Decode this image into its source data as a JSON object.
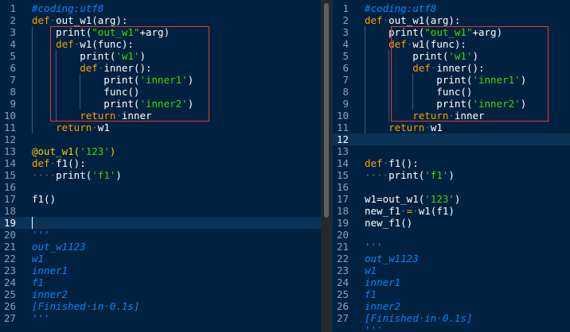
{
  "editor": {
    "left_pane": {
      "line_numbers": [
        "1",
        "2",
        "3",
        "4",
        "5",
        "6",
        "7",
        "8",
        "9",
        "10",
        "11",
        "12",
        "13",
        "14",
        "15",
        "16",
        "17",
        "18",
        "19",
        "20",
        "21",
        "22",
        "23",
        "24",
        "25",
        "26",
        "27"
      ],
      "active_line": 19,
      "lines": [
        [
          {
            "t": "#coding:utf8",
            "c": "c-comment"
          }
        ],
        [
          {
            "t": "def",
            "c": "c-key"
          },
          {
            "t": "·",
            "c": "ws-dot"
          },
          {
            "t": "out_w1",
            "c": "c-plain"
          },
          {
            "t": "(arg):",
            "c": "c-plain"
          }
        ],
        [
          {
            "t": "    print(",
            "c": "c-plain"
          },
          {
            "t": "\"out_w1\"",
            "c": "c-str"
          },
          {
            "t": "+arg)",
            "c": "c-plain"
          }
        ],
        [
          {
            "t": "    ",
            "c": "c-plain"
          },
          {
            "t": "def",
            "c": "c-key"
          },
          {
            "t": "·",
            "c": "ws-dot"
          },
          {
            "t": "w1(func):",
            "c": "c-plain"
          }
        ],
        [
          {
            "t": "        print(",
            "c": "c-plain"
          },
          {
            "t": "'w1'",
            "c": "c-str"
          },
          {
            "t": ")",
            "c": "c-plain"
          }
        ],
        [
          {
            "t": "        ",
            "c": "c-plain"
          },
          {
            "t": "def",
            "c": "c-key"
          },
          {
            "t": "·",
            "c": "ws-dot"
          },
          {
            "t": "inner():",
            "c": "c-plain"
          }
        ],
        [
          {
            "t": "            print(",
            "c": "c-plain"
          },
          {
            "t": "'inner1'",
            "c": "c-str"
          },
          {
            "t": ")",
            "c": "c-plain"
          }
        ],
        [
          {
            "t": "            func()",
            "c": "c-plain"
          }
        ],
        [
          {
            "t": "            print(",
            "c": "c-plain"
          },
          {
            "t": "'inner2'",
            "c": "c-str"
          },
          {
            "t": ")",
            "c": "c-plain"
          }
        ],
        [
          {
            "t": "        ",
            "c": "c-plain"
          },
          {
            "t": "return",
            "c": "c-key"
          },
          {
            "t": "·",
            "c": "ws-dot"
          },
          {
            "t": "inner",
            "c": "c-plain"
          }
        ],
        [
          {
            "t": "    ",
            "c": "c-plain"
          },
          {
            "t": "return",
            "c": "c-key"
          },
          {
            "t": "·",
            "c": "ws-dot"
          },
          {
            "t": "w1",
            "c": "c-plain"
          }
        ],
        [],
        [
          {
            "t": "@out_w1(",
            "c": "c-deco"
          },
          {
            "t": "'123'",
            "c": "c-str"
          },
          {
            "t": ")",
            "c": "c-deco"
          }
        ],
        [
          {
            "t": "def",
            "c": "c-key"
          },
          {
            "t": "·",
            "c": "ws-dot"
          },
          {
            "t": "f1():",
            "c": "c-plain"
          }
        ],
        [
          {
            "t": "····",
            "c": "ws-dot"
          },
          {
            "t": "print(",
            "c": "c-plain"
          },
          {
            "t": "'f1'",
            "c": "c-str"
          },
          {
            "t": ")",
            "c": "c-plain"
          }
        ],
        [],
        [
          {
            "t": "f1()",
            "c": "c-plain"
          }
        ],
        [],
        [],
        [
          {
            "t": "'''",
            "c": "c-comment"
          }
        ],
        [
          {
            "t": "out_w1123",
            "c": "c-comment"
          }
        ],
        [
          {
            "t": "w1",
            "c": "c-comment"
          }
        ],
        [
          {
            "t": "inner1",
            "c": "c-comment"
          }
        ],
        [
          {
            "t": "f1",
            "c": "c-comment"
          }
        ],
        [
          {
            "t": "inner2",
            "c": "c-comment"
          }
        ],
        [
          {
            "t": "[Finished",
            "c": "c-comment"
          },
          {
            "t": "·",
            "c": "ws-dot"
          },
          {
            "t": "in",
            "c": "c-comment"
          },
          {
            "t": "·",
            "c": "ws-dot"
          },
          {
            "t": "0.1s]",
            "c": "c-comment"
          }
        ],
        [
          {
            "t": "'''",
            "c": "c-comment"
          }
        ]
      ]
    },
    "right_pane": {
      "line_numbers": [
        "1",
        "2",
        "3",
        "4",
        "5",
        "6",
        "7",
        "8",
        "9",
        "10",
        "11",
        "12",
        "13",
        "14",
        "15",
        "16",
        "17",
        "18",
        "19",
        "20",
        "21",
        "22",
        "23",
        "24",
        "25",
        "26",
        "27"
      ],
      "active_line": 12,
      "lines": [
        [
          {
            "t": "#coding:utf8",
            "c": "c-comment"
          }
        ],
        [
          {
            "t": "def",
            "c": "c-key"
          },
          {
            "t": "·",
            "c": "ws-dot"
          },
          {
            "t": "out_w1",
            "c": "c-plain"
          },
          {
            "t": "(arg):",
            "c": "c-plain"
          }
        ],
        [
          {
            "t": "    print(",
            "c": "c-plain"
          },
          {
            "t": "\"out_w1\"",
            "c": "c-str"
          },
          {
            "t": "+arg)",
            "c": "c-plain"
          }
        ],
        [
          {
            "t": "    ",
            "c": "c-plain"
          },
          {
            "t": "def",
            "c": "c-key"
          },
          {
            "t": "·",
            "c": "ws-dot"
          },
          {
            "t": "w1(func):",
            "c": "c-plain"
          }
        ],
        [
          {
            "t": "        print(",
            "c": "c-plain"
          },
          {
            "t": "'w1'",
            "c": "c-str"
          },
          {
            "t": ")",
            "c": "c-plain"
          }
        ],
        [
          {
            "t": "        ",
            "c": "c-plain"
          },
          {
            "t": "def",
            "c": "c-key"
          },
          {
            "t": "·",
            "c": "ws-dot"
          },
          {
            "t": "inner():",
            "c": "c-plain"
          }
        ],
        [
          {
            "t": "            print(",
            "c": "c-plain"
          },
          {
            "t": "'inner1'",
            "c": "c-str"
          },
          {
            "t": ")",
            "c": "c-plain"
          }
        ],
        [
          {
            "t": "            func()",
            "c": "c-plain"
          }
        ],
        [
          {
            "t": "            print(",
            "c": "c-plain"
          },
          {
            "t": "'inner2'",
            "c": "c-str"
          },
          {
            "t": ")",
            "c": "c-plain"
          }
        ],
        [
          {
            "t": "        ",
            "c": "c-plain"
          },
          {
            "t": "return",
            "c": "c-key"
          },
          {
            "t": "·",
            "c": "ws-dot"
          },
          {
            "t": "inner",
            "c": "c-plain"
          }
        ],
        [
          {
            "t": "    ",
            "c": "c-plain"
          },
          {
            "t": "return",
            "c": "c-key"
          },
          {
            "t": "·",
            "c": "ws-dot"
          },
          {
            "t": "w1",
            "c": "c-plain"
          }
        ],
        [],
        [],
        [
          {
            "t": "def",
            "c": "c-key"
          },
          {
            "t": "·",
            "c": "ws-dot"
          },
          {
            "t": "f1():",
            "c": "c-plain"
          }
        ],
        [
          {
            "t": "····",
            "c": "ws-dot"
          },
          {
            "t": "print(",
            "c": "c-plain"
          },
          {
            "t": "'f1'",
            "c": "c-str"
          },
          {
            "t": ")",
            "c": "c-plain"
          }
        ],
        [],
        [
          {
            "t": "w1=out_w1(",
            "c": "c-plain"
          },
          {
            "t": "'123'",
            "c": "c-str"
          },
          {
            "t": ")",
            "c": "c-plain"
          }
        ],
        [
          {
            "t": "new_f1",
            "c": "c-plain"
          },
          {
            "t": "·",
            "c": "ws-dot"
          },
          {
            "t": "=",
            "c": "c-key"
          },
          {
            "t": "·",
            "c": "ws-dot"
          },
          {
            "t": "w1(f1)",
            "c": "c-plain"
          }
        ],
        [
          {
            "t": "new_f1()",
            "c": "c-plain"
          }
        ],
        [],
        [
          {
            "t": "'''",
            "c": "c-comment"
          }
        ],
        [
          {
            "t": "out_w1123",
            "c": "c-comment"
          }
        ],
        [
          {
            "t": "w1",
            "c": "c-comment"
          }
        ],
        [
          {
            "t": "inner1",
            "c": "c-comment"
          }
        ],
        [
          {
            "t": "f1",
            "c": "c-comment"
          }
        ],
        [
          {
            "t": "inner2",
            "c": "c-comment"
          }
        ],
        [
          {
            "t": "[Finished",
            "c": "c-comment"
          },
          {
            "t": "·",
            "c": "ws-dot"
          },
          {
            "t": "in",
            "c": "c-comment"
          },
          {
            "t": "·",
            "c": "ws-dot"
          },
          {
            "t": "0.1s]",
            "c": "c-comment"
          }
        ],
        [
          {
            "t": "'''",
            "c": "c-comment"
          }
        ]
      ]
    }
  },
  "colors": {
    "background": "#002240",
    "keyword": "#ff9d00",
    "string": "#3ad900",
    "comment": "#0088ff",
    "decorator": "#ffc600",
    "annotation_box": "#e03a3a"
  }
}
